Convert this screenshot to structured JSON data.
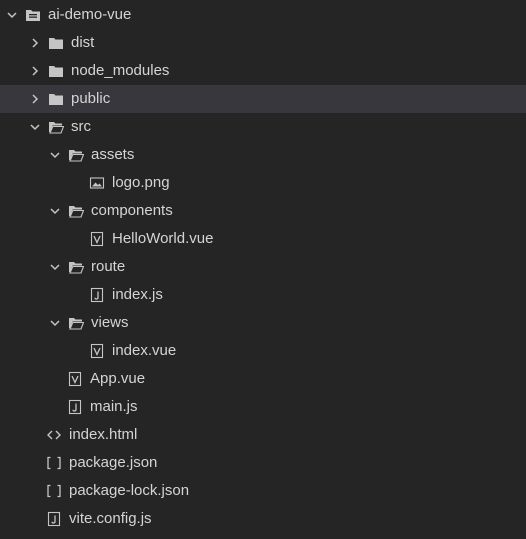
{
  "explorer": {
    "root": {
      "label": "ai-demo-vue"
    },
    "dist": {
      "label": "dist"
    },
    "node_modules": {
      "label": "node_modules"
    },
    "public": {
      "label": "public"
    },
    "src": {
      "label": "src"
    },
    "assets": {
      "label": "assets"
    },
    "logo": {
      "label": "logo.png"
    },
    "components": {
      "label": "components"
    },
    "helloworld": {
      "label": "HelloWorld.vue"
    },
    "route": {
      "label": "route"
    },
    "route_index": {
      "label": "index.js"
    },
    "views": {
      "label": "views"
    },
    "views_index": {
      "label": "index.vue"
    },
    "app": {
      "label": "App.vue"
    },
    "main": {
      "label": "main.js"
    },
    "index_html": {
      "label": "index.html"
    },
    "package_json": {
      "label": "package.json"
    },
    "package_lock": {
      "label": "package-lock.json"
    },
    "vite_config": {
      "label": "vite.config.js"
    }
  },
  "colors": {
    "background": "#252526",
    "selected_row": "#37373d",
    "text": "#d4d4d4",
    "icon": "#c5c5c5"
  },
  "icons": {
    "collapsed_folder": "folder-icon",
    "open_folder": "folder-open-icon",
    "image_file": "image-file-icon",
    "vue_file": "vue-file-icon",
    "js_file": "js-file-icon",
    "html_file": "code-brackets-icon",
    "json_file": "json-brackets-icon",
    "expand": "chevron-right-icon",
    "collapse": "chevron-down-icon"
  }
}
